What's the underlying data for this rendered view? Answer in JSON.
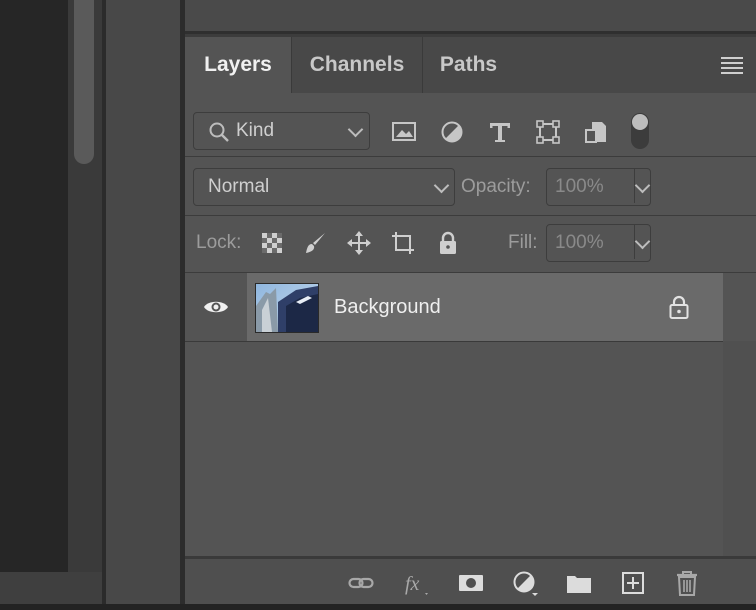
{
  "tabs": [
    "Layers",
    "Channels",
    "Paths"
  ],
  "filter": {
    "kind_label": "Kind",
    "icons": [
      "image-filter-icon",
      "adjustment-filter-icon",
      "type-filter-icon",
      "shape-filter-icon",
      "smart-object-filter-icon",
      "filter-toggle-icon"
    ]
  },
  "blend": {
    "mode": "Normal",
    "opacity_label": "Opacity:",
    "opacity_value": "100%"
  },
  "lock": {
    "label": "Lock:",
    "fill_label": "Fill:",
    "fill_value": "100%",
    "icons": [
      "lock-transparent-pixels-icon",
      "lock-image-pixels-icon",
      "lock-position-icon",
      "lock-artboard-icon",
      "lock-all-icon"
    ]
  },
  "layers": [
    {
      "name": "Background",
      "visible": true,
      "locked": true
    }
  ],
  "footer_icons": [
    "link-layers-icon",
    "fx-icon",
    "add-mask-icon",
    "new-adjustment-icon",
    "new-group-icon",
    "new-layer-icon",
    "delete-layer-icon"
  ],
  "colors": {
    "panel_bg": "#545454",
    "selected_layer": "#6a6a6a",
    "text": "#d6d6d6"
  }
}
